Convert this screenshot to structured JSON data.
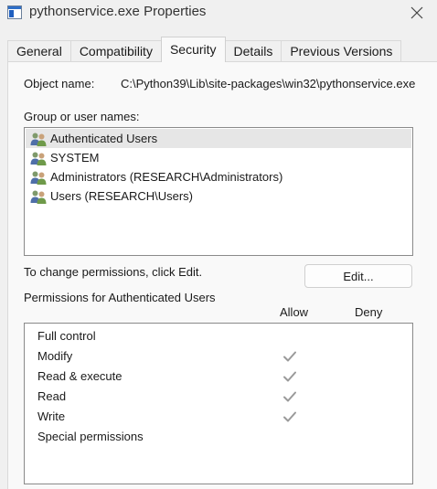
{
  "window": {
    "title": "pythonservice.exe Properties"
  },
  "tabs": [
    {
      "label": "General",
      "active": false
    },
    {
      "label": "Compatibility",
      "active": false
    },
    {
      "label": "Security",
      "active": true
    },
    {
      "label": "Details",
      "active": false
    },
    {
      "label": "Previous Versions",
      "active": false
    }
  ],
  "security": {
    "object_label": "Object name:",
    "object_value": "C:\\Python39\\Lib\\site-packages\\win32\\pythonservice.exe",
    "group_label": "Group or user names:",
    "users": [
      {
        "name": "Authenticated Users",
        "selected": true
      },
      {
        "name": "SYSTEM",
        "selected": false
      },
      {
        "name": "Administrators (RESEARCH\\Administrators)",
        "selected": false
      },
      {
        "name": "Users (RESEARCH\\Users)",
        "selected": false
      }
    ],
    "change_text": "To change permissions, click Edit.",
    "edit_label": "Edit...",
    "permissions_label": "Permissions for Authenticated Users",
    "allow_header": "Allow",
    "deny_header": "Deny",
    "permissions": [
      {
        "name": "Full control",
        "allow": false,
        "deny": false
      },
      {
        "name": "Modify",
        "allow": true,
        "deny": false
      },
      {
        "name": "Read & execute",
        "allow": true,
        "deny": false
      },
      {
        "name": "Read",
        "allow": true,
        "deny": false
      },
      {
        "name": "Write",
        "allow": true,
        "deny": false
      },
      {
        "name": "Special permissions",
        "allow": false,
        "deny": false
      }
    ]
  },
  "colors": {
    "check": "#9a9a9a",
    "selection": "#e6e6e6"
  }
}
